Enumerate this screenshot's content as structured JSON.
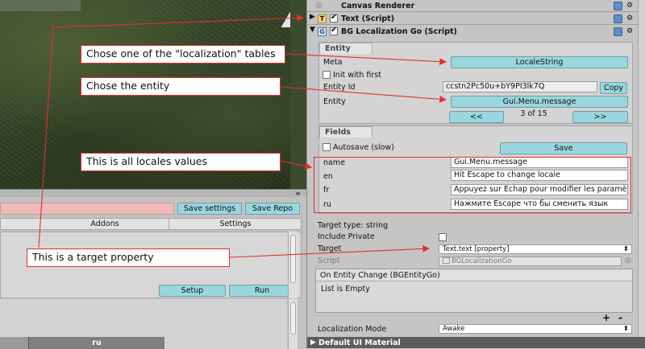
{
  "inspector": {
    "canvas_renderer": "Canvas Renderer",
    "text_script": "Text (Script)",
    "bg_component": "BG Localization Go (Script)",
    "entity_section": "Entity",
    "meta_label": "Meta",
    "meta_value": "LocaleString",
    "init_first_label": "Init with first",
    "entity_id_label": "Entity Id",
    "entity_id_value": "ccstn2Pc50u+bY9PI3lk7Q",
    "copy_button": "Copy",
    "entity_label": "Entity",
    "entity_value": "Gui.Menu.message",
    "prev_button": "<<",
    "page_counter": "3 of 15",
    "next_button": ">>",
    "fields_section": "Fields",
    "autosave_label": "Autosave (slow)",
    "save_button": "Save",
    "fields": [
      {
        "name": "name",
        "value": "Gui.Menu.message"
      },
      {
        "name": "en",
        "value": "Hit Escape to change locale"
      },
      {
        "name": "fr",
        "value": "Appuyez sur Échap pour modifier les paramè"
      },
      {
        "name": "ru",
        "value": "Нажмите Escape что бы сменить язык"
      }
    ],
    "target_type": "Target type: string",
    "include_private": "Include Private",
    "target_label": "Target",
    "target_value": "Text.text [property]",
    "script_label": "Script",
    "script_value": "BGLocalizationGo",
    "event_title": "On Entity Change (BGEntityGo)",
    "event_list": "List is Empty",
    "plus": "+",
    "minus": "-",
    "mode_label": "Localization Mode",
    "mode_value": "Awake",
    "default_material": "Default UI Material"
  },
  "editor": {
    "save_settings": "Save settings",
    "save_repo": "Save Repo",
    "tab_addons": "Addons",
    "tab_settings": "Settings",
    "setup_button": "Setup",
    "run_button": "Run",
    "col_ru": "ru"
  },
  "annotations": {
    "note1": "Chose one of the \"localization\" tables",
    "note2": "Chose the entity",
    "note3": "This is all locales values",
    "note4": "This is a target property"
  },
  "colors": {
    "accent_button": "#9ad6de",
    "annotation_red": "#e03030"
  }
}
